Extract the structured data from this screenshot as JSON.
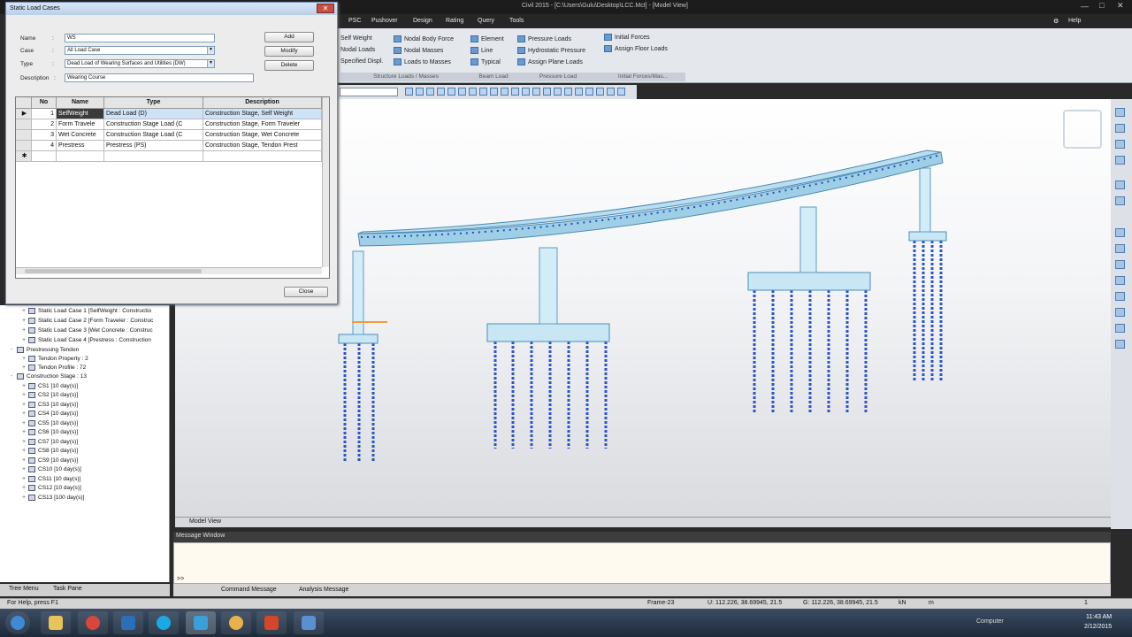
{
  "app": {
    "title": "Civil 2015 - [C:\\Users\\Gulu\\Desktop\\LCC.Mct] - [Model View]",
    "menu": [
      "PSC",
      "Pushover",
      "Design",
      "Rating",
      "Query",
      "Tools"
    ],
    "help_label": "Help"
  },
  "ribbon": {
    "col1": [
      "Self Weight",
      "Nodal Loads",
      "Specified Displ."
    ],
    "col2": [
      "Nodal Body Force",
      "Nodal Masses",
      "Loads to Masses"
    ],
    "col3": [
      "Element",
      "Line",
      "Typical"
    ],
    "col4": [
      "Pressure Loads",
      "Hydrostatic Pressure",
      "Assign Plane Loads"
    ],
    "col5": [
      "Initial Forces",
      "Assign Floor Loads"
    ],
    "groups": [
      "Structure Loads / Masses",
      "Beam Load",
      "Pressure Load",
      "Initial Forces/Mas..."
    ]
  },
  "dialog": {
    "title": "Static Load Cases",
    "name_label": "Name",
    "name_value": "WS",
    "case_label": "Case",
    "case_value": "All Load Case",
    "type_label": "Type",
    "type_value": "Dead Load of Wearing Surfaces and Utilities (DW)",
    "description_label": "Description",
    "description_value": "Wearing Course",
    "add_label": "Add",
    "modify_label": "Modify",
    "delete_label": "Delete",
    "close_label": "Close",
    "columns": [
      "No",
      "Name",
      "Type",
      "Description"
    ],
    "rows": [
      {
        "no": "1",
        "name": "SelfWeight",
        "type": "Dead Load (D)",
        "desc": "Construction Stage, Self Weight"
      },
      {
        "no": "2",
        "name": "Form Travele",
        "type": "Construction Stage Load (C",
        "desc": "Construction Stage, Form Traveler"
      },
      {
        "no": "3",
        "name": "Wet Concrete",
        "type": "Construction Stage Load (C",
        "desc": "Construction Stage, Wet Concrete"
      },
      {
        "no": "4",
        "name": "Prestress",
        "type": "Prestress (PS)",
        "desc": "Construction Stage, Tendon Prest"
      }
    ]
  },
  "tree": {
    "items": [
      "Static Load Case 1 [SelfWeight : Constructio",
      "Static Load Case 2 [Form Traveler : Construc",
      "Static Load Case 3 [Wet Concrete : Construc",
      "Static Load Case 4 [Prestress : Construction",
      "Prestressing Tendon",
      "Tendon Property : 2",
      "Tendon Profile : 72",
      "Construction Stage : 13",
      "CS1 [10 day(s)]",
      "CS2 [10 day(s)]",
      "CS3 [10 day(s)]",
      "CS4 [10 day(s)]",
      "CS5 [10 day(s)]",
      "CS6 [10 day(s)]",
      "CS7 [10 day(s)]",
      "CS8 [10 day(s)]",
      "CS9 [10 day(s)]",
      "CS10 [10 day(s)]",
      "CS11 [10 day(s)]",
      "CS12 [10 day(s)]",
      "CS13 [100 day(s)]"
    ],
    "tab_tree": "Tree Menu",
    "tab_task": "Task Pane"
  },
  "viewport": {
    "tab_label": "Model View"
  },
  "messages": {
    "header": "Message Window",
    "prompt": ">>",
    "tab_command": "Command Message",
    "tab_analysis": "Analysis Message"
  },
  "status": {
    "help": "For Help, press F1",
    "frame": "Frame-23",
    "coord_u": "U: 112.226, 38.69945, 21.5",
    "coord_g": "G: 112.226, 38.69945, 21.5",
    "unit": "kN",
    "len_unit": "m",
    "page": "1"
  },
  "taskbar": {
    "time": "11:43 AM",
    "date": "2/12/2015",
    "computer": "Computer"
  }
}
